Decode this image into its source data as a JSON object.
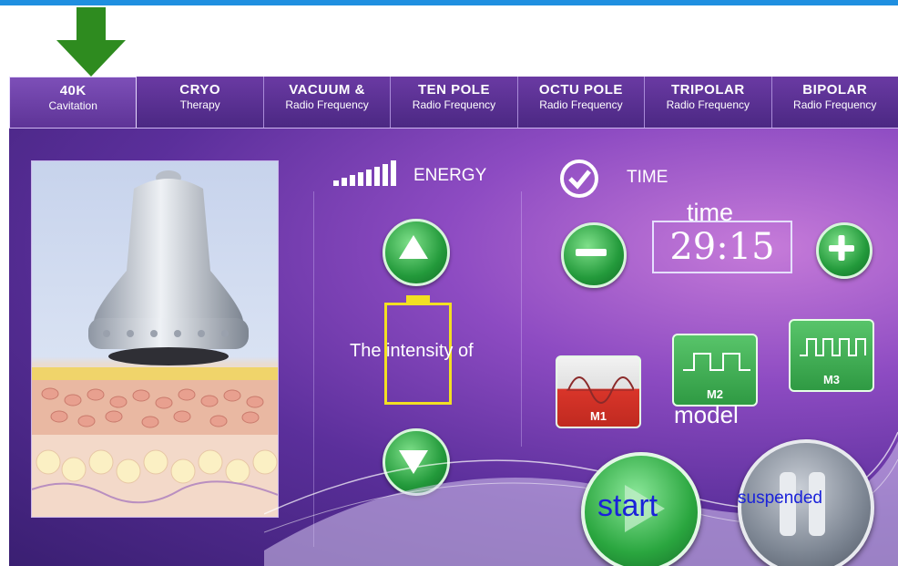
{
  "tabs": [
    {
      "title": "40K",
      "subtitle": "Cavitation",
      "active": true
    },
    {
      "title": "CRYO",
      "subtitle": "Therapy",
      "active": false
    },
    {
      "title": "VACUUM &",
      "subtitle": "Radio Frequency",
      "active": false
    },
    {
      "title": "TEN POLE",
      "subtitle": "Radio Frequency",
      "active": false
    },
    {
      "title": "OCTU POLE",
      "subtitle": "Radio Frequency",
      "active": false
    },
    {
      "title": "TRIPOLAR",
      "subtitle": "Radio Frequency",
      "active": false
    },
    {
      "title": "BIPOLAR",
      "subtitle": "Radio Frequency",
      "active": false
    }
  ],
  "energy": {
    "label": "ENERGY",
    "intensity_text": "The intensity of"
  },
  "time": {
    "label": "TIME",
    "caption": "time",
    "value": "29:15"
  },
  "modes": [
    {
      "label": "M1",
      "color": "#d9352a"
    },
    {
      "label": "M2",
      "color": "#3aa64a"
    },
    {
      "label": "M3",
      "color": "#3aa64a"
    }
  ],
  "model_label": "model",
  "start_label": "start",
  "suspend_label": "suspended",
  "colors": {
    "accent_green": "#2aa63f",
    "arrow_green": "#2e8b1f",
    "text_blue": "#1a22d9"
  }
}
